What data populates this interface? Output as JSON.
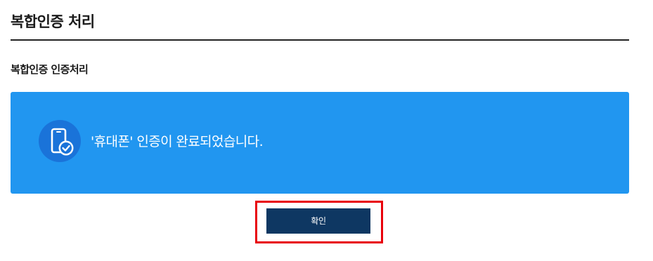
{
  "page": {
    "title": "복합인증 처리"
  },
  "section": {
    "title": "복합인증 인증처리"
  },
  "result": {
    "message": "'휴대폰' 인증이 완료되었습니다.",
    "icon": "phone-check-icon"
  },
  "actions": {
    "confirm_label": "확인"
  },
  "colors": {
    "panel": "#2196f0",
    "button": "#0e3762",
    "highlight": "#e8000b"
  }
}
